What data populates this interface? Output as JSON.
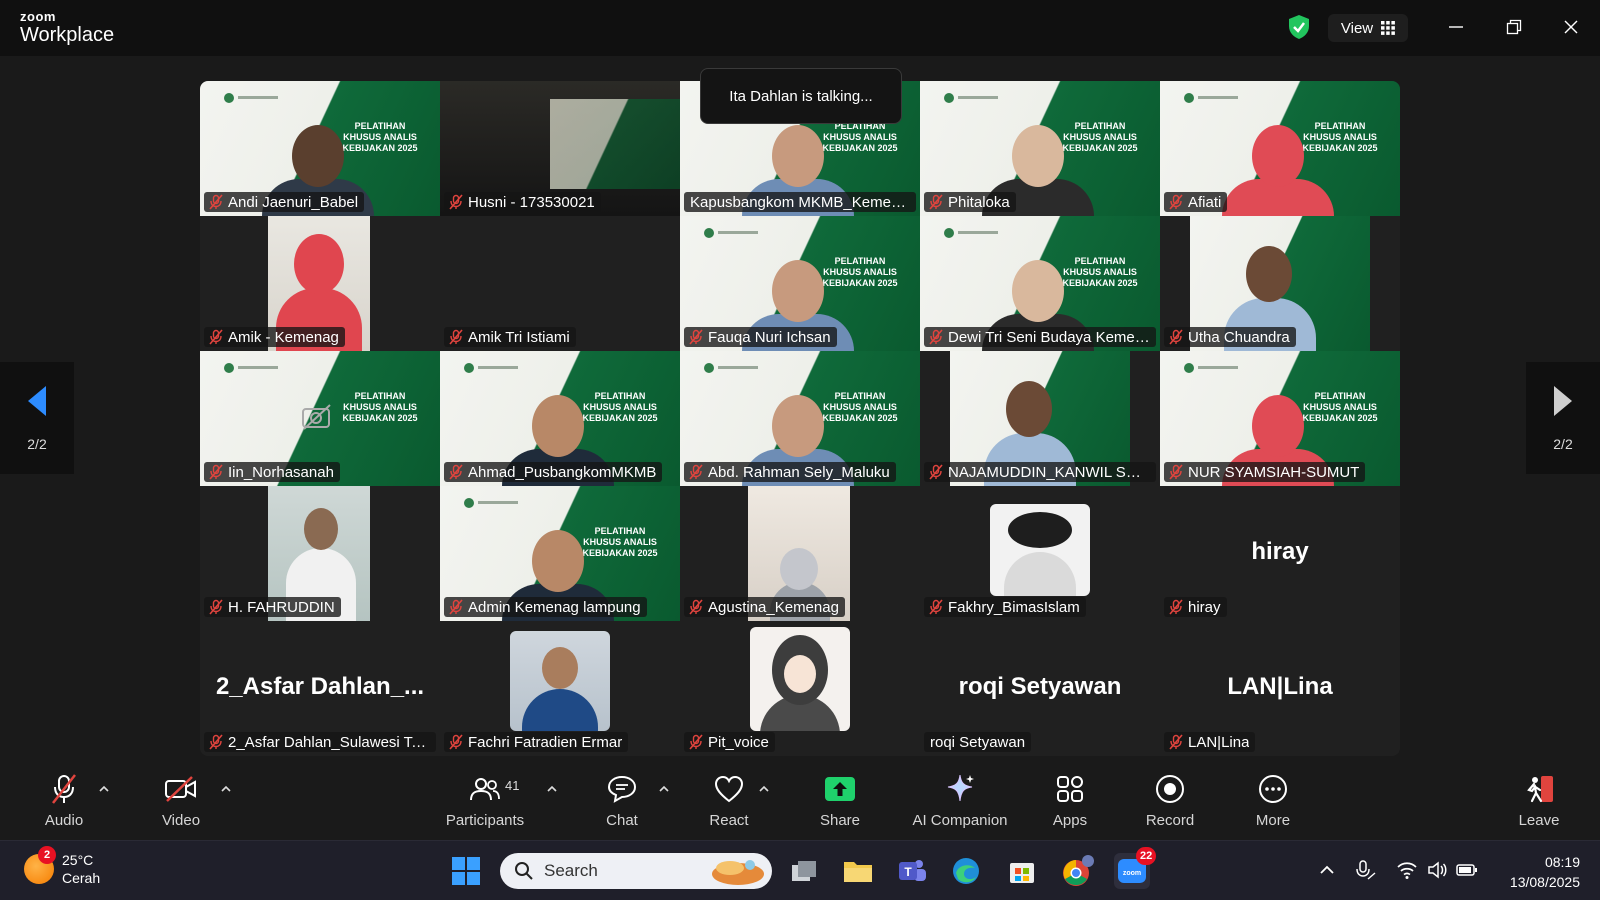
{
  "app": {
    "logo_top": "zoom",
    "logo_bottom": "Workplace"
  },
  "titlebar": {
    "view_label": "View"
  },
  "status": {
    "talking": "Ita Dahlan is talking..."
  },
  "pager": {
    "left": "2/2",
    "right": "2/2"
  },
  "participants": [
    {
      "name": "Andi Jaenuri_Babel",
      "muted": true,
      "bg": "banner"
    },
    {
      "name": "Husni - 173530021",
      "muted": true,
      "bg": "dark"
    },
    {
      "name": "Kapusbangkom MKMB_Kemenag",
      "muted": false,
      "bg": "banner"
    },
    {
      "name": "Phitaloka",
      "muted": true,
      "bg": "banner"
    },
    {
      "name": "Afiati",
      "muted": true,
      "bg": "banner"
    },
    {
      "name": "Amik - Kemenag",
      "muted": true,
      "bg": "portrait"
    },
    {
      "name": "Amik Tri Istiami",
      "muted": true,
      "bg": "gray"
    },
    {
      "name": "Fauqa Nuri Ichsan",
      "muted": true,
      "bg": "banner"
    },
    {
      "name": "Dewi Tri Seni Budaya Kemen...",
      "muted": true,
      "bg": "banner"
    },
    {
      "name": "Utha Chuandra",
      "muted": true,
      "bg": "portrait-banner"
    },
    {
      "name": "Iin_Norhasanah",
      "muted": true,
      "bg": "banner",
      "camera_off": true
    },
    {
      "name": "Ahmad_PusbangkomMKMB",
      "muted": true,
      "bg": "banner"
    },
    {
      "name": "Abd. Rahman Sely_Maluku",
      "muted": true,
      "bg": "banner"
    },
    {
      "name": "NAJAMUDDIN_KANWIL SUL...",
      "muted": true,
      "bg": "portrait-banner"
    },
    {
      "name": "NUR SYAMSIAH-SUMUT",
      "muted": true,
      "bg": "banner"
    },
    {
      "name": "H. FAHRUDDIN",
      "muted": true,
      "bg": "portrait-office"
    },
    {
      "name": "Admin Kemenag lampung",
      "muted": true,
      "bg": "banner"
    },
    {
      "name": "Agustina_Kemenag",
      "muted": true,
      "bg": "portrait-room"
    },
    {
      "name": "Fakhry_BimasIslam",
      "muted": true,
      "bg": "avatar-cap"
    },
    {
      "name": "hiray",
      "muted": true,
      "bg": "text",
      "display": "hiray"
    },
    {
      "name": "2_Asfar Dahlan_Sulawesi Te...",
      "muted": true,
      "bg": "text",
      "display": "2_Asfar  Dahlan_..."
    },
    {
      "name": "Fachri Fatradien Ermar",
      "muted": true,
      "bg": "avatar-photo"
    },
    {
      "name": "Pit_voice",
      "muted": true,
      "bg": "avatar-cartoon"
    },
    {
      "name": "roqi Setyawan",
      "muted": false,
      "bg": "text",
      "display": "roqi Setyawan"
    },
    {
      "name": "LAN|Lina",
      "muted": true,
      "bg": "text",
      "display": "LAN|Lina"
    }
  ],
  "banner": {
    "line1": "PELATIHAN",
    "line2": "KHUSUS ANALIS",
    "line3": "KEBIJAKAN 2025"
  },
  "toolbar": {
    "audio": "Audio",
    "video": "Video",
    "participants": "Participants",
    "participants_count": "41",
    "chat": "Chat",
    "react": "React",
    "share": "Share",
    "ai": "AI Companion",
    "apps": "Apps",
    "record": "Record",
    "more": "More",
    "leave": "Leave"
  },
  "taskbar": {
    "weather_badge": "2",
    "temperature": "25°C",
    "condition": "Cerah",
    "search_placeholder": "Search",
    "zoom_badge": "22",
    "time": "08:19",
    "date": "13/08/2025"
  },
  "colors": {
    "mute_red": "#e0443e",
    "share_green": "#1fd16c",
    "banner_green": "#0d6133",
    "leave_red": "#e0443e"
  }
}
